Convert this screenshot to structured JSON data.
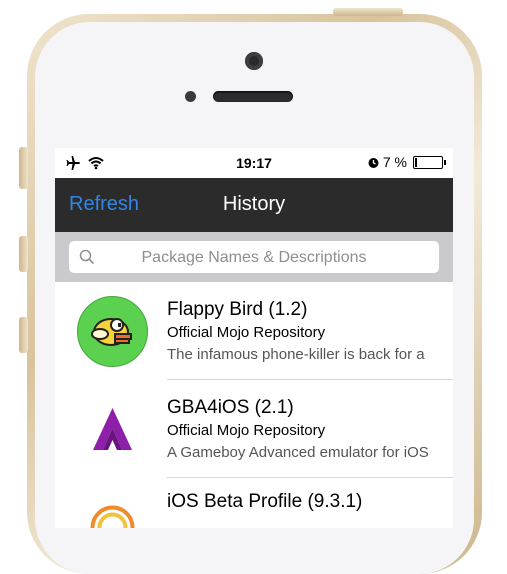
{
  "status_bar": {
    "airplane_icon": "airplane-icon",
    "wifi_icon": "wifi-icon",
    "time": "19:17",
    "alarm_icon": "alarm-icon",
    "battery_percent": "7 %",
    "battery_level": 0.07
  },
  "nav": {
    "refresh_label": "Refresh",
    "title": "History"
  },
  "search": {
    "placeholder": "Package Names & Descriptions"
  },
  "packages": [
    {
      "name": "Flappy Bird (1.2)",
      "source": "Official Mojo Repository",
      "description": "The infamous phone-killer is back for a"
    },
    {
      "name": "GBA4iOS (2.1)",
      "source": "Official Mojo Repository",
      "description": "A Gameboy Advanced emulator for iOS"
    },
    {
      "name": "iOS Beta Profile (9.3.1)",
      "source": "",
      "description": ""
    }
  ],
  "colors": {
    "accent_blue": "#2f86e8",
    "navbar_bg": "#2b2b2b",
    "gba_purple": "#8e1fa8",
    "flappy_green": "#5cd04f"
  }
}
